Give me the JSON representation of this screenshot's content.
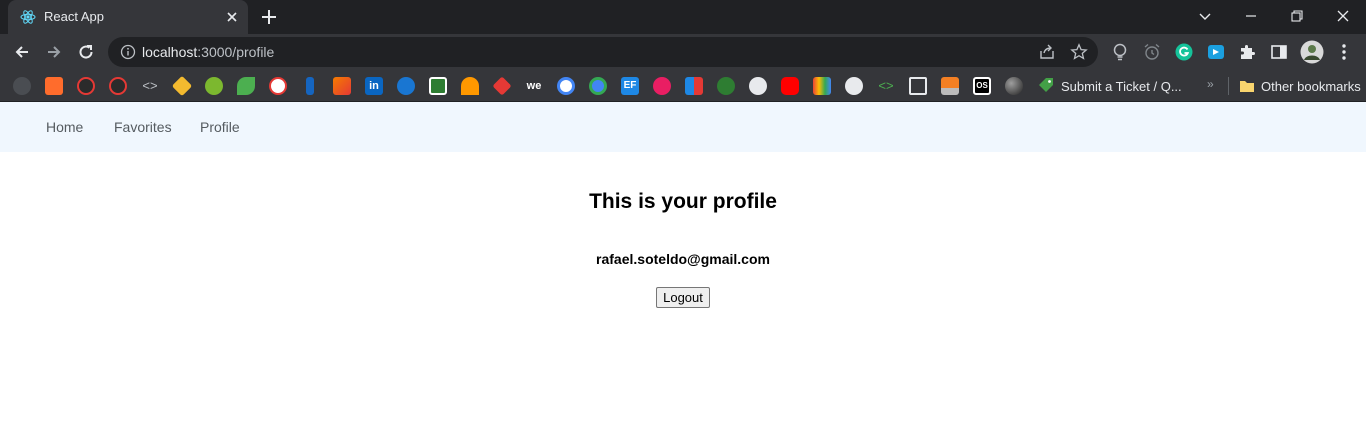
{
  "browser": {
    "tab": {
      "title": "React App",
      "favicon": "react-atom-icon"
    },
    "address": {
      "host": "localhost",
      "path": ":3000/profile"
    },
    "bookmarks": {
      "icons": [
        "github-icon",
        "cpanel-icon",
        "gitlab-icon",
        "gitlab-icon",
        "code-brackets-icon",
        "binance-icon",
        "green-circle-icon",
        "leaf-icon",
        "dt-icon",
        "facebook-icon",
        "chart-icon",
        "linkedin-icon",
        "m-icon",
        "play-icon",
        "hotjar-icon",
        "heart-icon",
        "we-icon",
        "google-icon",
        "cloud-icon",
        "ef-icon",
        "firefox-icon",
        "flag-icon",
        "shield-icon",
        "globe-icon",
        "youtube-icon",
        "gmail-icon",
        "globe-icon",
        "code-icon",
        "square-icon",
        "stackoverflow-icon",
        "os-icon",
        "sphere-icon"
      ],
      "ticket_label": "Submit a Ticket / Q...",
      "chevron": "»",
      "other_label": "Other bookmarks"
    }
  },
  "nav": {
    "home": "Home",
    "favorites": "Favorites",
    "profile": "Profile"
  },
  "profile": {
    "heading": "This is your profile",
    "email": "rafael.soteldo@gmail.com",
    "logout_label": "Logout"
  },
  "colors": {
    "navbar_bg": "#f0f7fe",
    "chrome_dark": "#202124",
    "chrome_toolbar": "#35363a"
  }
}
